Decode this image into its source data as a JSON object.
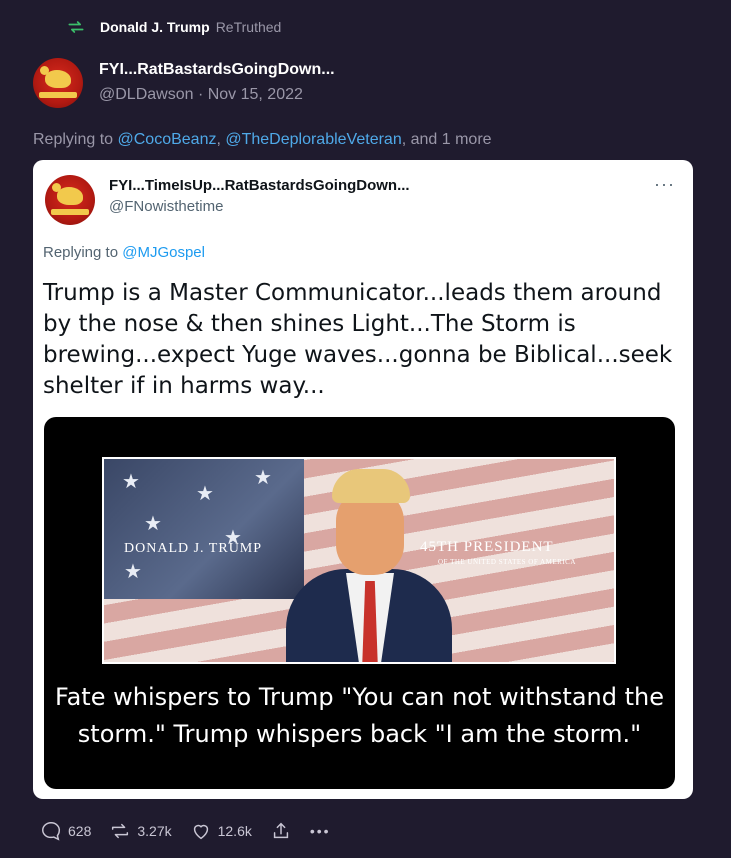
{
  "retruth": {
    "user": "Donald J. Trump",
    "label": "ReTruthed"
  },
  "author": {
    "display_name": "FYI...RatBastardsGoingDown...",
    "handle": "@DLDawson",
    "date": "Nov 15, 2022",
    "separator": " · "
  },
  "replying": {
    "prefix": "Replying to ",
    "mention_1": "@CocoBeanz",
    "comma": ", ",
    "mention_2": "@TheDeplorableVeteran",
    "suffix": ", and 1 more"
  },
  "quoted": {
    "display_name": "FYI...TimeIsUp...RatBastardsGoingDown...",
    "handle": "@FNowisthetime",
    "more": "···",
    "replying_prefix": "Replying to ",
    "replying_mention": "@MJGospel",
    "body": "Trump is a Master Communicator...leads them around by the nose & then shines Light...The Storm is brewing...expect Yuge waves...gonna be Biblical...seek shelter if in harms way...",
    "image": {
      "label_left": "DONALD J. TRUMP",
      "label_right": "45TH PRESIDENT",
      "label_sub": "OF THE UNITED STATES OF AMERICA",
      "caption": "Fate whispers to Trump \"You can not withstand the storm.\"  Trump whispers back \"I am the storm.\""
    }
  },
  "actions": {
    "replies": "628",
    "retruths": "3.27k",
    "likes": "12.6k",
    "more": "•••"
  },
  "colors": {
    "background": "#1f1b2e",
    "link": "#4fa9e8",
    "muted": "#9a97a8",
    "retruth_icon": "#3bbf6a"
  }
}
